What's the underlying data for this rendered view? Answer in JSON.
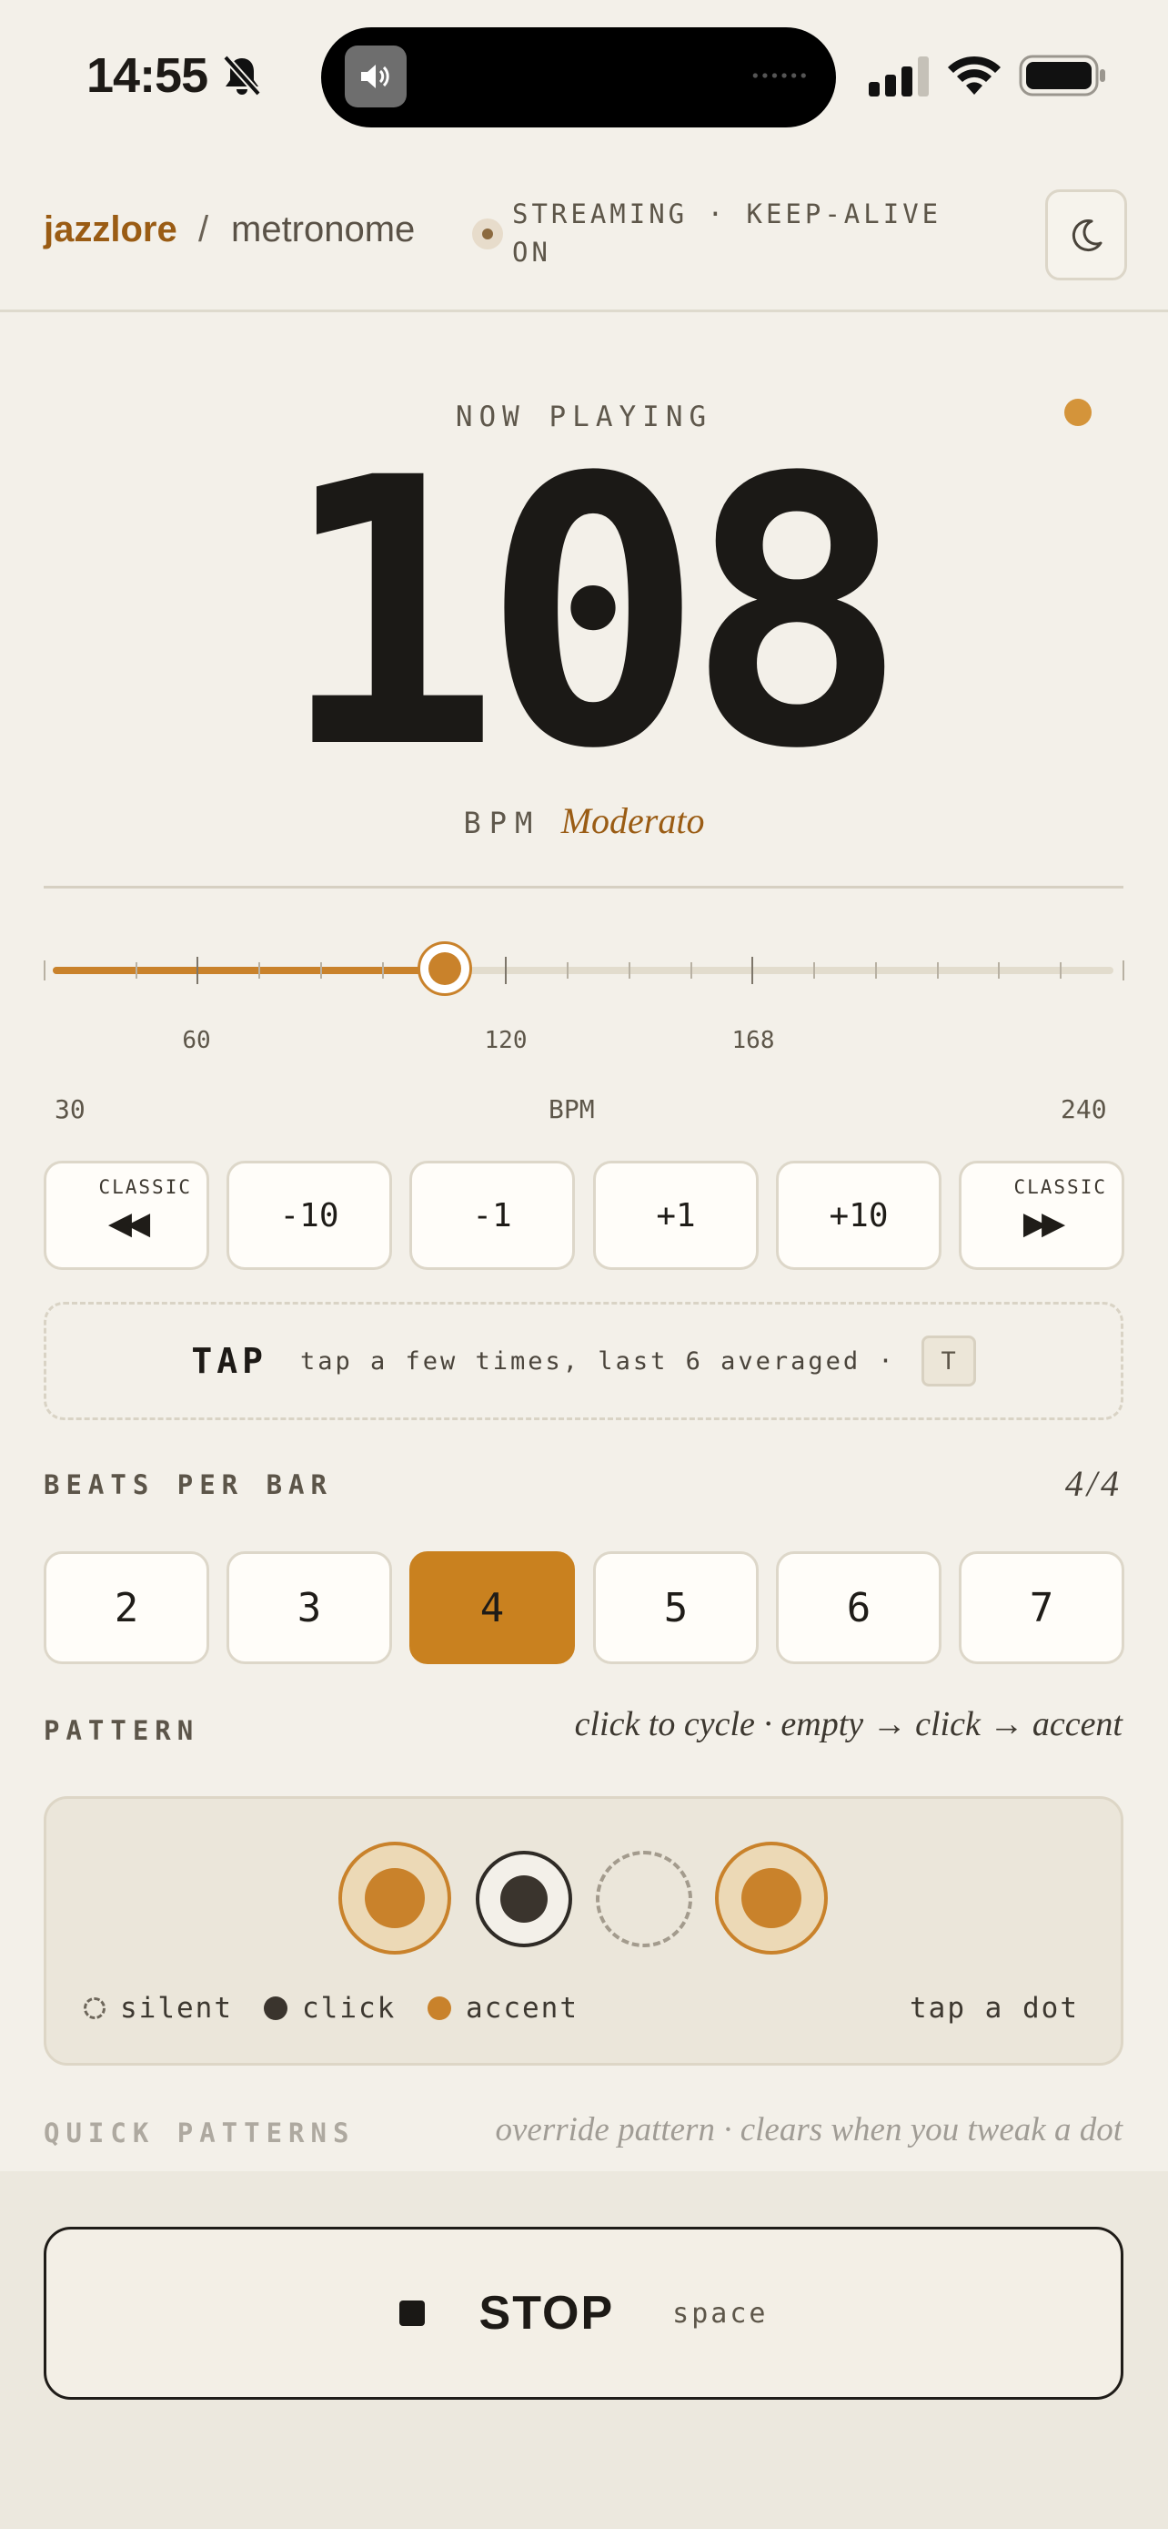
{
  "status_bar": {
    "time": "14:55"
  },
  "header": {
    "brand": "jazzlore",
    "separator": "/",
    "page": "metronome",
    "stream_status": "STREAMING · KEEP-ALIVE ON"
  },
  "now_playing": {
    "label": "NOW PLAYING",
    "bpm": "108",
    "unit": "BPM",
    "tempo_name": "Moderato"
  },
  "slider": {
    "min": 30,
    "max": 240,
    "value": 108,
    "tick_labels": [
      "60",
      "120",
      "168"
    ],
    "min_label": "30",
    "mid_label": "BPM",
    "max_label": "240"
  },
  "adjust_buttons": {
    "classic_prev": "CLASSIC",
    "prev_arrow": "◀◀",
    "minus10": "-10",
    "minus1": "-1",
    "plus1": "+1",
    "plus10": "+10",
    "classic_next": "CLASSIC",
    "next_arrow": "▶▶"
  },
  "tap": {
    "label": "TAP",
    "hint": "tap a few times, last 6 averaged ·",
    "key": "T"
  },
  "beats": {
    "label": "BEATS PER BAR",
    "signature": "4/4",
    "options": [
      "2",
      "3",
      "4",
      "5",
      "6",
      "7"
    ],
    "selected": "4"
  },
  "pattern": {
    "label": "PATTERN",
    "hint": "click to cycle · empty → click → accent",
    "beats": [
      "accent",
      "click",
      "silent",
      "accent"
    ],
    "legend_silent": "silent",
    "legend_click": "click",
    "legend_accent": "accent",
    "tap_hint": "tap a dot"
  },
  "quick_patterns": {
    "label": "QUICK PATTERNS",
    "hint": "override pattern · clears when you tweak a dot"
  },
  "transport": {
    "stop_label": "STOP",
    "shortcut": "space"
  },
  "colors": {
    "accent": "#c9822b",
    "brand": "#9a5c14",
    "background": "#f3f0e9"
  }
}
